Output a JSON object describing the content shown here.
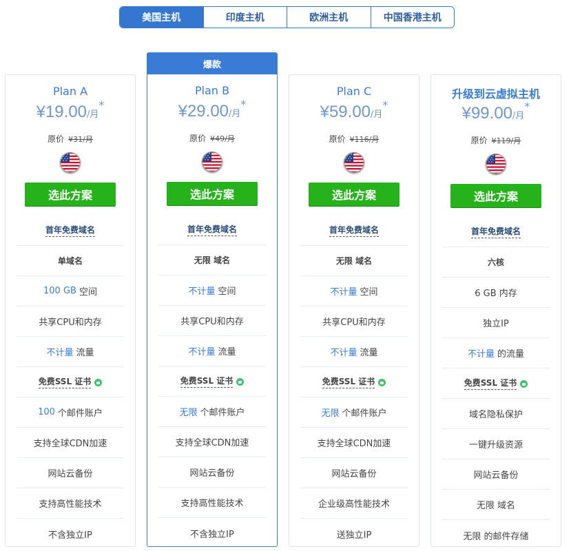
{
  "tabs": [
    {
      "label": "美国主机",
      "active": true
    },
    {
      "label": "印度主机",
      "active": false
    },
    {
      "label": "欧洲主机",
      "active": false
    },
    {
      "label": "中国香港主机",
      "active": false
    }
  ],
  "badge": "爆款",
  "select_label": "选此方案",
  "orig_prefix": "原价",
  "colors": {
    "accent": "#3a7bd5",
    "button": "#26b21a"
  },
  "plans": [
    {
      "name": "Plan A",
      "currency": "¥",
      "price": "19.00",
      "unit": "/月",
      "star": "*",
      "orig": "¥31/月",
      "flag": "us-flag-icon",
      "features": [
        {
          "text": "首年免费域名"
        },
        {
          "text": "单域名"
        },
        {
          "hl": "100 GB",
          "text": "空间"
        },
        {
          "text": "共享CPU和内存"
        },
        {
          "hl": "不计量",
          "text": "流量"
        },
        {
          "text": "免费SSL 证书"
        },
        {
          "hl": "100",
          "text": "个邮件账户"
        },
        {
          "text": "支持全球CDN加速"
        },
        {
          "text": "网站云备份"
        },
        {
          "text": "支持高性能技术"
        },
        {
          "text": "不含独立IP"
        }
      ]
    },
    {
      "name": "Plan B",
      "currency": "¥",
      "price": "29.00",
      "unit": "/月",
      "star": "*",
      "orig": "¥49/月",
      "flag": "us-flag-icon",
      "features": [
        {
          "text": "首年免费域名"
        },
        {
          "text": "无限 域名"
        },
        {
          "hl": "不计量",
          "text": "空间"
        },
        {
          "text": "共享CPU和内存"
        },
        {
          "hl": "不计量",
          "text": "流量"
        },
        {
          "text": "免费SSL 证书"
        },
        {
          "hl": "无限",
          "text": "个邮件账户"
        },
        {
          "text": "支持全球CDN加速"
        },
        {
          "text": "网站云备份"
        },
        {
          "text": "支持高性能技术"
        },
        {
          "text": "不含独立IP"
        }
      ]
    },
    {
      "name": "Plan C",
      "currency": "¥",
      "price": "59.00",
      "unit": "/月",
      "star": "*",
      "orig": "¥116/月",
      "flag": "us-flag-icon",
      "features": [
        {
          "text": "首年免费域名"
        },
        {
          "text": "无限 域名"
        },
        {
          "hl": "不计量",
          "text": "空间"
        },
        {
          "text": "共享CPU和内存"
        },
        {
          "hl": "不计量",
          "text": "流量"
        },
        {
          "text": "免费SSL 证书"
        },
        {
          "hl": "无限",
          "text": "个邮件账户"
        },
        {
          "text": "支持全球CDN加速"
        },
        {
          "text": "网站云备份"
        },
        {
          "text": "企业级高性能技术"
        },
        {
          "text": "送独立IP"
        }
      ]
    },
    {
      "name": "升级到云虚拟主机",
      "currency": "¥",
      "price": "99.00",
      "unit": "/月",
      "star": "*",
      "orig": "¥119/月",
      "flag": "us-flag-icon",
      "features": [
        {
          "text": "首年免费域名"
        },
        {
          "text": "六核"
        },
        {
          "text": "6 GB 内存"
        },
        {
          "text": "独立IP"
        },
        {
          "hl": "不计量",
          "text": "的流量"
        },
        {
          "text": "免费SSL 证书"
        },
        {
          "text": "域名隐私保护"
        },
        {
          "text": "一键升级资源"
        },
        {
          "text": "网站云备份"
        },
        {
          "text": "无限 域名"
        },
        {
          "text": "无限 的邮件存储"
        }
      ]
    }
  ]
}
